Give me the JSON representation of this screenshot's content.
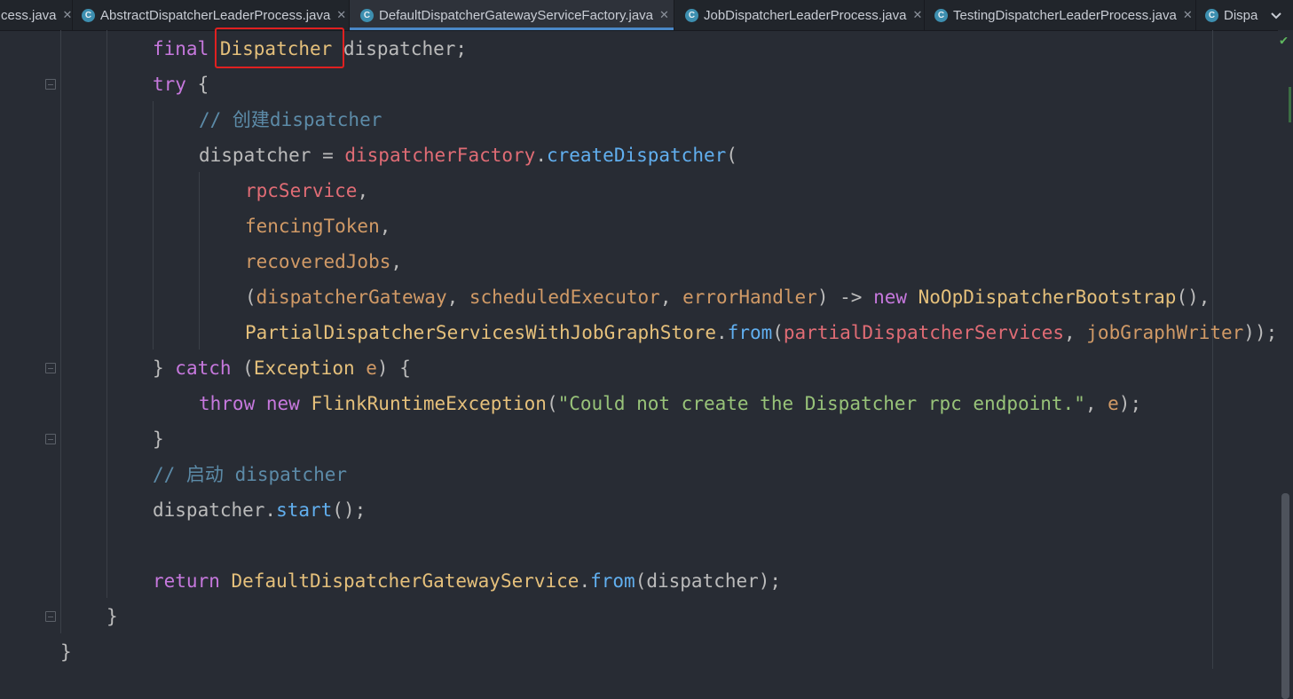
{
  "tabs": [
    {
      "label": "cess.java",
      "icon": null,
      "active": false
    },
    {
      "label": "AbstractDispatcherLeaderProcess.java",
      "icon": "class-icon",
      "active": false
    },
    {
      "label": "DefaultDispatcherGatewayServiceFactory.java",
      "icon": "class-icon",
      "active": true
    },
    {
      "label": "JobDispatcherLeaderProcess.java",
      "icon": "class-icon",
      "active": false
    },
    {
      "label": "TestingDispatcherLeaderProcess.java",
      "icon": "class-icon",
      "active": false
    },
    {
      "label": "Dispa",
      "icon": "class-icon",
      "active": false
    }
  ],
  "tab_icon_letter": "C",
  "close_glyph": "✕",
  "highlight_color": "#e02020",
  "code_lines": [
    [
      {
        "t": "final ",
        "c": "kw"
      },
      {
        "t": "Dispatcher",
        "c": "ty"
      },
      {
        "t": " dispatcher;",
        "c": "pl"
      }
    ],
    [
      {
        "t": "try ",
        "c": "kw"
      },
      {
        "t": "{",
        "c": "pl"
      }
    ],
    [
      {
        "t": "// 创建dispatcher",
        "c": "cm"
      }
    ],
    [
      {
        "t": "dispatcher = ",
        "c": "pl"
      },
      {
        "t": "dispatcherFactory",
        "c": "fld"
      },
      {
        "t": ".",
        "c": "pl"
      },
      {
        "t": "createDispatcher",
        "c": "mt"
      },
      {
        "t": "(",
        "c": "pl"
      }
    ],
    [
      {
        "t": "rpcService",
        "c": "fld"
      },
      {
        "t": ",",
        "c": "pl"
      }
    ],
    [
      {
        "t": "fencingToken",
        "c": "par"
      },
      {
        "t": ",",
        "c": "pl"
      }
    ],
    [
      {
        "t": "recoveredJobs",
        "c": "par"
      },
      {
        "t": ",",
        "c": "pl"
      }
    ],
    [
      {
        "t": "(",
        "c": "pl"
      },
      {
        "t": "dispatcherGateway",
        "c": "par"
      },
      {
        "t": ", ",
        "c": "pl"
      },
      {
        "t": "scheduledExecutor",
        "c": "par"
      },
      {
        "t": ", ",
        "c": "pl"
      },
      {
        "t": "errorHandler",
        "c": "par"
      },
      {
        "t": ") -> ",
        "c": "pl"
      },
      {
        "t": "new ",
        "c": "kw"
      },
      {
        "t": "NoOpDispatcherBootstrap",
        "c": "ty"
      },
      {
        "t": "(),",
        "c": "pl"
      }
    ],
    [
      {
        "t": "PartialDispatcherServicesWithJobGraphStore",
        "c": "ty"
      },
      {
        "t": ".",
        "c": "pl"
      },
      {
        "t": "from",
        "c": "mt"
      },
      {
        "t": "(",
        "c": "pl"
      },
      {
        "t": "partialDispatcherServices",
        "c": "fld"
      },
      {
        "t": ", ",
        "c": "pl"
      },
      {
        "t": "jobGraphWriter",
        "c": "par"
      },
      {
        "t": "));",
        "c": "pl"
      }
    ],
    [
      {
        "t": "} ",
        "c": "pl"
      },
      {
        "t": "catch ",
        "c": "kw"
      },
      {
        "t": "(",
        "c": "pl"
      },
      {
        "t": "Exception ",
        "c": "ty"
      },
      {
        "t": "e",
        "c": "par"
      },
      {
        "t": ") {",
        "c": "pl"
      }
    ],
    [
      {
        "t": "throw ",
        "c": "kw"
      },
      {
        "t": "new ",
        "c": "kw"
      },
      {
        "t": "FlinkRuntimeException",
        "c": "ty"
      },
      {
        "t": "(",
        "c": "pl"
      },
      {
        "t": "\"Could not create the Dispatcher rpc endpoint.\"",
        "c": "str"
      },
      {
        "t": ", ",
        "c": "pl"
      },
      {
        "t": "e",
        "c": "par"
      },
      {
        "t": ");",
        "c": "pl"
      }
    ],
    [
      {
        "t": "}",
        "c": "pl"
      }
    ],
    [
      {
        "t": "// 启动 dispatcher",
        "c": "cm"
      }
    ],
    [
      {
        "t": "dispatcher.",
        "c": "pl"
      },
      {
        "t": "start",
        "c": "mt"
      },
      {
        "t": "();",
        "c": "pl"
      }
    ],
    [],
    [
      {
        "t": "return ",
        "c": "kw"
      },
      {
        "t": "DefaultDispatcherGatewayService",
        "c": "ty"
      },
      {
        "t": ".",
        "c": "pl"
      },
      {
        "t": "from",
        "c": "mt"
      },
      {
        "t": "(dispatcher);",
        "c": "pl"
      }
    ],
    [
      {
        "t": "}",
        "c": "pl"
      }
    ],
    [
      {
        "t": "}",
        "c": "pl"
      }
    ]
  ]
}
